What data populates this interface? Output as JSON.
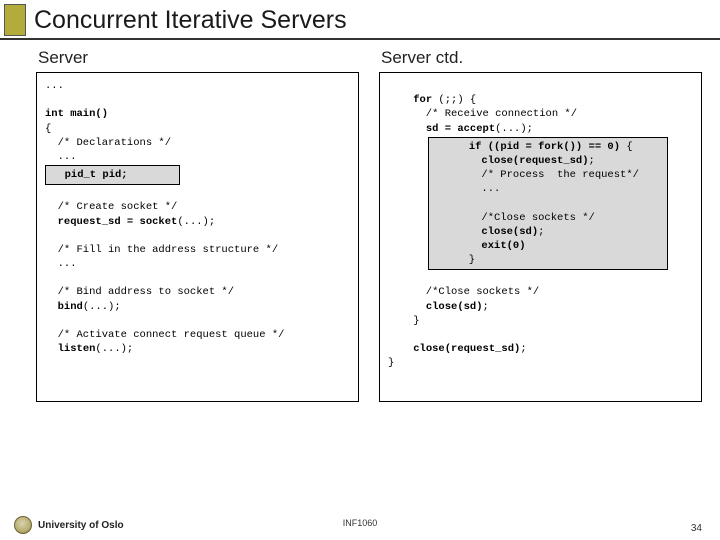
{
  "title": "Concurrent Iterative Servers",
  "left": {
    "header": "Server",
    "l0": "...",
    "l1": "int main()",
    "l2": "{",
    "l3": "  /* Declarations */",
    "l4": "  ...",
    "hl1": "  pid_t pid;",
    "l5": "  /* Create socket */",
    "l6": "  request_sd = socket(...);",
    "l7": "  /* Fill in the address structure */",
    "l8": "  ...",
    "l9": "  /* Bind address to socket */",
    "l10": "  bind(...);",
    "l11": "  /* Activate connect request queue */",
    "l12": "  listen(...);"
  },
  "right": {
    "header": "Server ctd.",
    "r0": "    for (;;) {",
    "r1": "      /* Receive connection */",
    "r2": "      sd = accept(...);",
    "h0": "      if ((pid = fork()) == 0) {",
    "h1": "        close(request_sd);",
    "h2": "        /* Process  the request*/",
    "h3": "        ...",
    "h4": "        /*Close sockets */",
    "h5": "        close(sd);",
    "h6": "        exit(0)",
    "h7": "      }",
    "r3": "      /*Close sockets */",
    "r4": "      close(sd);",
    "r5": "    }",
    "r6": "    close(request_sd);",
    "r7": "}"
  },
  "footer": {
    "university": "University of Oslo",
    "course": "INF1060",
    "page": "34"
  }
}
